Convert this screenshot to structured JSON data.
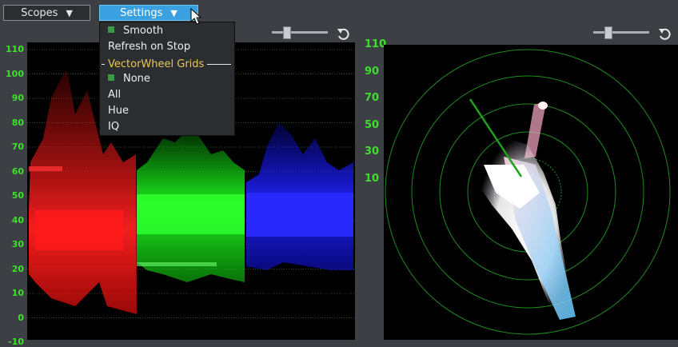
{
  "toolbar": {
    "scopes_label": "Scopes",
    "settings_label": "Settings"
  },
  "settings_menu": {
    "smooth": "Smooth",
    "refresh_on_stop": "Refresh on Stop",
    "section_title": "VectorWheel Grids",
    "none": "None",
    "all": "All",
    "hue": "Hue",
    "iq": "IQ",
    "checked_items": [
      "Smooth",
      "None"
    ]
  },
  "waveform": {
    "ticks": [
      "110",
      "100",
      "90",
      "80",
      "70",
      "60",
      "50",
      "40",
      "30",
      "20",
      "10",
      "0",
      "-10"
    ]
  },
  "vectorscope": {
    "ticks": [
      "110",
      "90",
      "70",
      "50",
      "30",
      "10"
    ]
  },
  "colors": {
    "axis": "#3de02b",
    "accent": "#3aa0e0",
    "check": "#3a9a45"
  },
  "icons": {
    "reset": "reset-rotate-icon",
    "cursor": "mouse-pointer-icon"
  }
}
